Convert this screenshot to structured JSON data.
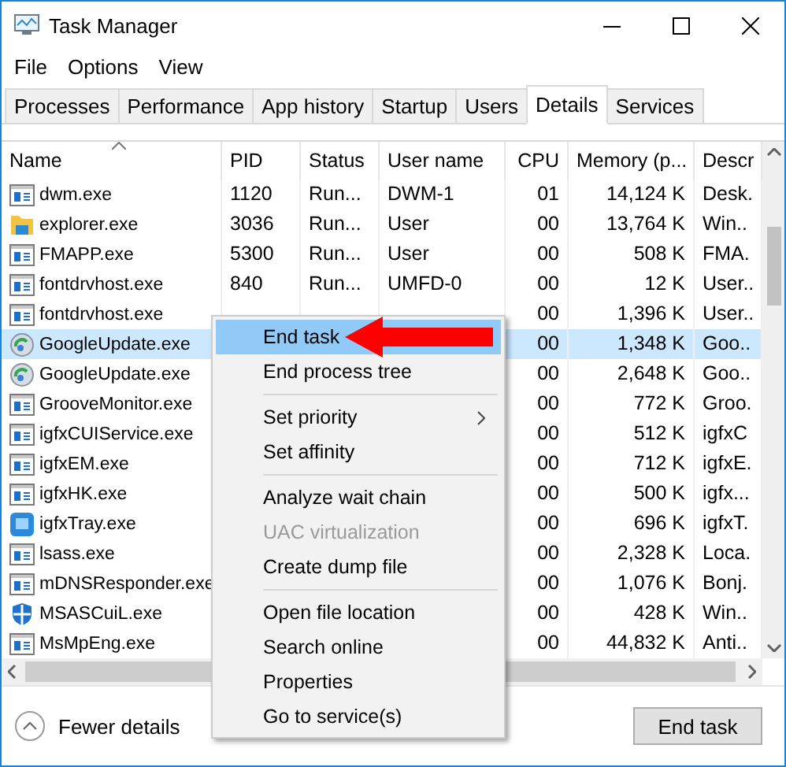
{
  "window": {
    "title": "Task Manager"
  },
  "menu_bar": [
    "File",
    "Options",
    "View"
  ],
  "tabs": [
    {
      "label": "Processes",
      "selected": false
    },
    {
      "label": "Performance",
      "selected": false
    },
    {
      "label": "App history",
      "selected": false
    },
    {
      "label": "Startup",
      "selected": false
    },
    {
      "label": "Users",
      "selected": false
    },
    {
      "label": "Details",
      "selected": true
    },
    {
      "label": "Services",
      "selected": false
    }
  ],
  "table": {
    "columns": [
      "Name",
      "PID",
      "Status",
      "User name",
      "CPU",
      "Memory (p...",
      "Descr"
    ],
    "rows": [
      {
        "kind": "app",
        "selected": false,
        "cells": [
          "dwm.exe",
          "1120",
          "Run...",
          "DWM-1",
          "01",
          "14,124 K",
          "Desk."
        ]
      },
      {
        "kind": "folder",
        "selected": false,
        "cells": [
          "explorer.exe",
          "3036",
          "Run...",
          "User",
          "00",
          "13,764 K",
          "Win.."
        ]
      },
      {
        "kind": "app",
        "selected": false,
        "cells": [
          "FMAPP.exe",
          "5300",
          "Run...",
          "User",
          "00",
          "508 K",
          "FMA."
        ]
      },
      {
        "kind": "app",
        "selected": false,
        "cells": [
          "fontdrvhost.exe",
          "840",
          "Run...",
          "UMFD-0",
          "00",
          "12 K",
          "User.."
        ]
      },
      {
        "kind": "app",
        "selected": false,
        "cells": [
          "fontdrvhost.exe",
          null,
          null,
          null,
          "00",
          "1,396 K",
          "User.."
        ]
      },
      {
        "kind": "update",
        "selected": true,
        "cells": [
          "GoogleUpdate.exe",
          null,
          null,
          null,
          "00",
          "1,348 K",
          "Goo.."
        ]
      },
      {
        "kind": "update",
        "selected": false,
        "cells": [
          "GoogleUpdate.exe",
          null,
          null,
          null,
          "00",
          "2,648 K",
          "Goo.."
        ]
      },
      {
        "kind": "app",
        "selected": false,
        "cells": [
          "GrooveMonitor.exe",
          null,
          null,
          null,
          "00",
          "772 K",
          "Groo."
        ]
      },
      {
        "kind": "app",
        "selected": false,
        "cells": [
          "igfxCUIService.exe",
          null,
          null,
          null,
          "00",
          "512 K",
          "igfxC"
        ]
      },
      {
        "kind": "app",
        "selected": false,
        "cells": [
          "igfxEM.exe",
          null,
          null,
          null,
          "00",
          "712 K",
          "igfxE."
        ]
      },
      {
        "kind": "app",
        "selected": false,
        "cells": [
          "igfxHK.exe",
          null,
          null,
          null,
          "00",
          "500 K",
          "igfx..."
        ]
      },
      {
        "kind": "tray",
        "selected": false,
        "cells": [
          "igfxTray.exe",
          null,
          null,
          null,
          "00",
          "696 K",
          "igfxT."
        ]
      },
      {
        "kind": "app",
        "selected": false,
        "cells": [
          "lsass.exe",
          null,
          null,
          null,
          "00",
          "2,328 K",
          "Loca."
        ]
      },
      {
        "kind": "app",
        "selected": false,
        "cells": [
          "mDNSResponder.exe",
          null,
          null,
          null,
          "00",
          "1,076 K",
          "Bonj."
        ]
      },
      {
        "kind": "shield",
        "selected": false,
        "cells": [
          "MSASCuiL.exe",
          null,
          null,
          null,
          "00",
          "428 K",
          "Win.."
        ]
      },
      {
        "kind": "app",
        "selected": false,
        "cells": [
          "MsMpEng.exe",
          null,
          null,
          null,
          "00",
          "44,832 K",
          "Anti.."
        ]
      }
    ]
  },
  "context_menu": [
    {
      "kind": "item",
      "label": "End task",
      "selected": true,
      "disabled": false,
      "submenu": false
    },
    {
      "kind": "item",
      "label": "End process tree",
      "selected": false,
      "disabled": false,
      "submenu": false
    },
    {
      "kind": "separator"
    },
    {
      "kind": "item",
      "label": "Set priority",
      "selected": false,
      "disabled": false,
      "submenu": true
    },
    {
      "kind": "item",
      "label": "Set affinity",
      "selected": false,
      "disabled": false,
      "submenu": false
    },
    {
      "kind": "separator"
    },
    {
      "kind": "item",
      "label": "Analyze wait chain",
      "selected": false,
      "disabled": false,
      "submenu": false
    },
    {
      "kind": "item",
      "label": "UAC virtualization",
      "selected": false,
      "disabled": true,
      "submenu": false
    },
    {
      "kind": "item",
      "label": "Create dump file",
      "selected": false,
      "disabled": false,
      "submenu": false
    },
    {
      "kind": "separator"
    },
    {
      "kind": "item",
      "label": "Open file location",
      "selected": false,
      "disabled": false,
      "submenu": false
    },
    {
      "kind": "item",
      "label": "Search online",
      "selected": false,
      "disabled": false,
      "submenu": false
    },
    {
      "kind": "item",
      "label": "Properties",
      "selected": false,
      "disabled": false,
      "submenu": false
    },
    {
      "kind": "item",
      "label": "Go to service(s)",
      "selected": false,
      "disabled": false,
      "submenu": false
    }
  ],
  "footer": {
    "toggle": "Fewer details",
    "button": "End task"
  }
}
